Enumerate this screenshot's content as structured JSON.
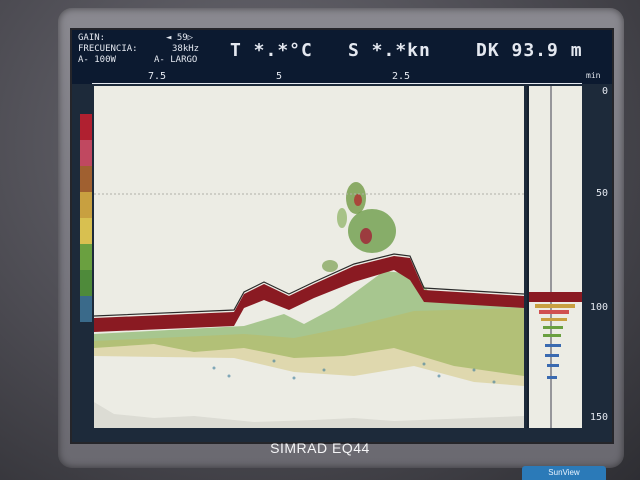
{
  "header": {
    "gain_label": "GAIN:",
    "gain_value": "◄ 59▷",
    "frequency_label": "FRECUENCIA:",
    "frequency_value": "38kHz",
    "power": "A- 100W",
    "range_mode": "A- LARGO",
    "temperature": "T *.*°C",
    "speed": "S *.*kn",
    "depth": "DK 93.9 m"
  },
  "horizontal_scale": {
    "ticks": [
      "7.5",
      "5",
      "2.5"
    ],
    "unit": "min"
  },
  "depth_scale": {
    "ticks": [
      "0",
      "50",
      "100",
      "150"
    ]
  },
  "colors": {
    "screen_bg": "#ecece4",
    "bottom_echo": "#8a1a22",
    "header_bg": "#0c1a30"
  },
  "device": {
    "brand": "SIMRAD EQ44",
    "badge": "SunView"
  }
}
